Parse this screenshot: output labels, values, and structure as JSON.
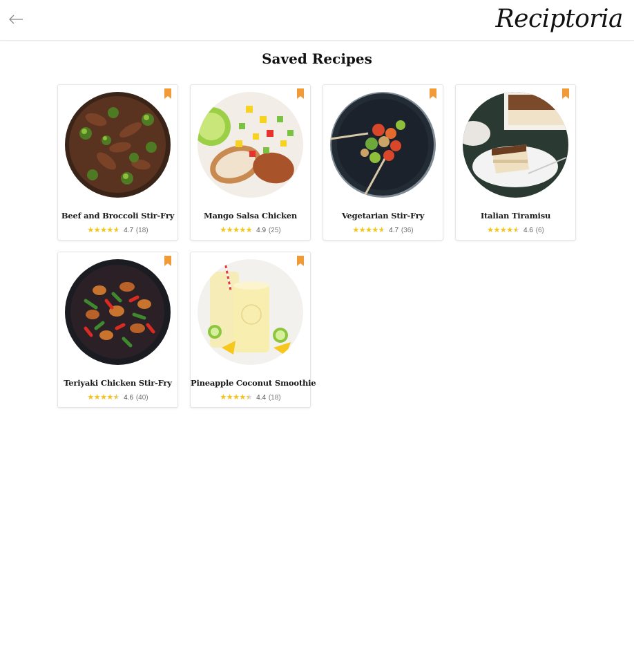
{
  "header": {
    "back_icon": "arrow-left-icon",
    "brand": "Reciptoria"
  },
  "page": {
    "title": "Saved Recipes"
  },
  "colors": {
    "accent": "#f29a38",
    "star": "#f5c518"
  },
  "recipes": [
    {
      "title": "Beef and Broccoli Stir-Fry",
      "rating": 4.7,
      "rating_text": "4.7",
      "count_text": "(18)",
      "stars": "★★★★★",
      "bookmark_icon": "bookmark-icon"
    },
    {
      "title": "Mango Salsa Chicken",
      "rating": 4.9,
      "rating_text": "4.9",
      "count_text": "(25)",
      "stars": "★★★★★",
      "bookmark_icon": "bookmark-icon"
    },
    {
      "title": "Vegetarian Stir-Fry",
      "rating": 4.7,
      "rating_text": "4.7",
      "count_text": "(36)",
      "stars": "★★★★★",
      "bookmark_icon": "bookmark-icon"
    },
    {
      "title": "Italian Tiramisu",
      "rating": 4.6,
      "rating_text": "4.6",
      "count_text": "(6)",
      "stars": "★★★★★",
      "bookmark_icon": "bookmark-icon"
    },
    {
      "title": "Teriyaki Chicken Stir-Fry",
      "rating": 4.6,
      "rating_text": "4.6",
      "count_text": "(40)",
      "stars": "★★★★★",
      "bookmark_icon": "bookmark-icon"
    },
    {
      "title": "Pineapple Coconut Smoothie",
      "rating": 4.4,
      "rating_text": "4.4",
      "count_text": "(18)",
      "stars": "★★★★★",
      "bookmark_icon": "bookmark-icon"
    }
  ]
}
